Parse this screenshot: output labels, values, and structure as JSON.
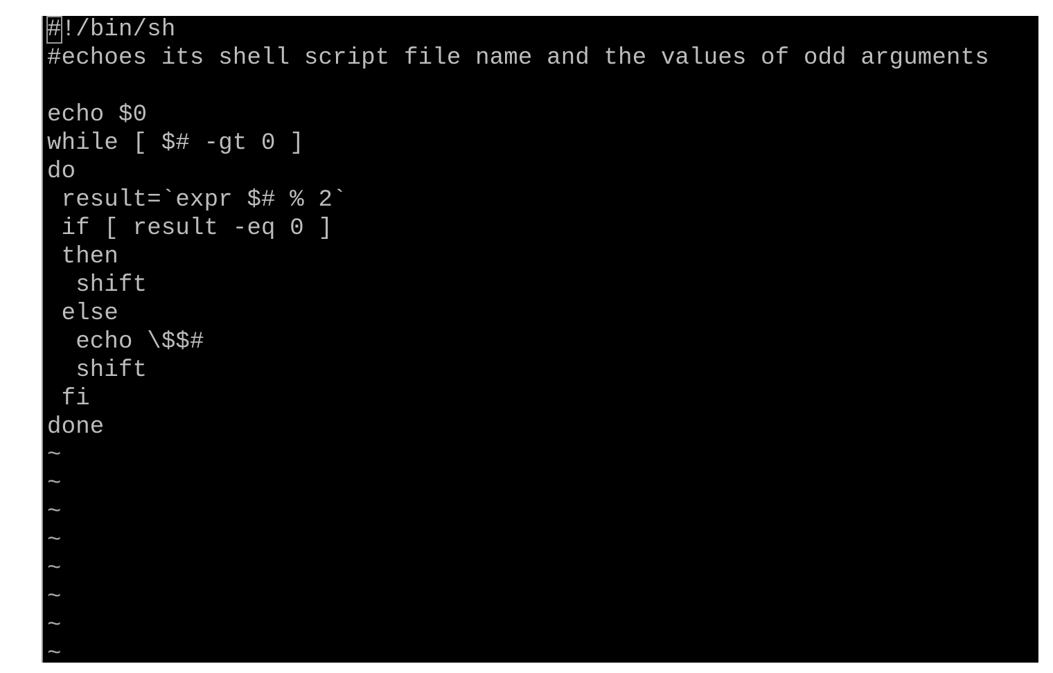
{
  "editor": {
    "cursor_char": "#",
    "first_line_rest": "!/bin/sh",
    "lines": [
      "#echoes its shell script file name and the values of odd arguments",
      "",
      "echo $0",
      "while [ $# -gt 0 ]",
      "do",
      " result=`expr $# % 2`",
      " if [ result -eq 0 ]",
      " then",
      "  shift",
      " else",
      "  echo \\$$#",
      "  shift",
      " fi",
      "done"
    ],
    "empty_line_marker": "~",
    "empty_line_count": 8,
    "colors": {
      "background": "#000000",
      "text": "#bdbdbd"
    }
  }
}
